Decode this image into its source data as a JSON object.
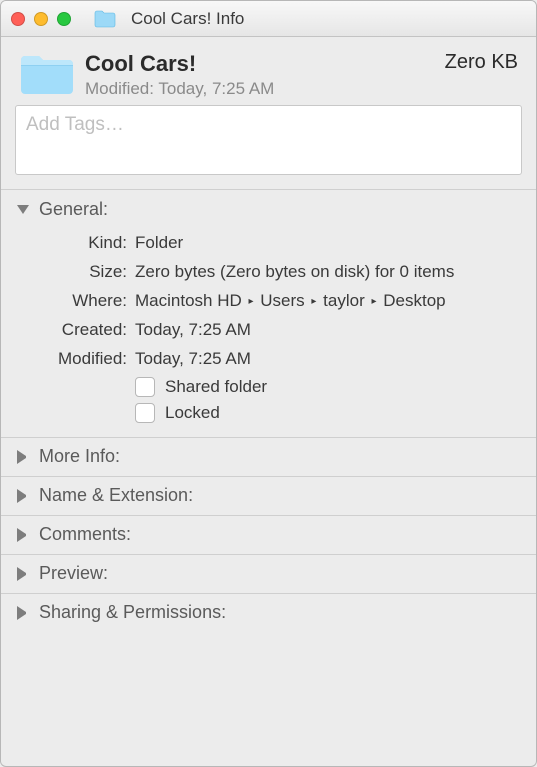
{
  "window": {
    "title": "Cool Cars! Info"
  },
  "header": {
    "name": "Cool Cars!",
    "modified": "Modified: Today, 7:25 AM",
    "size": "Zero KB"
  },
  "tags": {
    "placeholder": "Add Tags…"
  },
  "general": {
    "label": "General:",
    "kind_label": "Kind:",
    "kind_value": "Folder",
    "size_label": "Size:",
    "size_value": "Zero bytes (Zero bytes on disk) for 0 items",
    "where_label": "Where:",
    "where_parts": [
      "Macintosh HD",
      "Users",
      "taylor",
      "Desktop"
    ],
    "created_label": "Created:",
    "created_value": "Today, 7:25 AM",
    "modified_label": "Modified:",
    "modified_value": "Today, 7:25 AM",
    "shared_label": "Shared folder",
    "locked_label": "Locked"
  },
  "more_info": {
    "label": "More Info:"
  },
  "name_ext": {
    "label": "Name & Extension:"
  },
  "comments": {
    "label": "Comments:"
  },
  "preview": {
    "label": "Preview:"
  },
  "sharing": {
    "label": "Sharing & Permissions:"
  }
}
